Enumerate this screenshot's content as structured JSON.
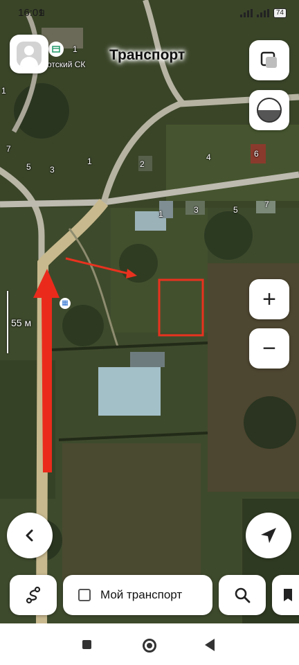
{
  "status_bar": {
    "time": "16:01",
    "carrier_glyph": "Я",
    "battery": "74"
  },
  "header": {
    "title": "Транспорт"
  },
  "map_labels": {
    "poi": "...отский СК",
    "house_numbers": [
      "1",
      "7",
      "5",
      "3",
      "1",
      "2",
      "4",
      "6",
      "3",
      "5",
      "7",
      "1",
      "1"
    ]
  },
  "scale": {
    "text": "55 м"
  },
  "controls": {
    "profile_icon": "user-icon",
    "layers_icon": "layers-icon",
    "compass_icon": "compass-icon",
    "zoom_in_label": "+",
    "zoom_out_label": "−",
    "back_icon": "chevron-left-icon",
    "locate_icon": "navigation-arrow-icon"
  },
  "bottom_bar": {
    "route_icon": "route-icon",
    "my_transport_label": "Мой транспорт",
    "my_transport_checked": false,
    "search_icon": "search-icon",
    "bookmarks_icon": "bookmark-icon"
  },
  "system_nav": {
    "recent_icon": "square-icon",
    "home_icon": "circle-icon",
    "back_icon": "triangle-back-icon"
  },
  "colors": {
    "annotation_red": "#e8321f",
    "map_dark": "#3b4a2a"
  }
}
